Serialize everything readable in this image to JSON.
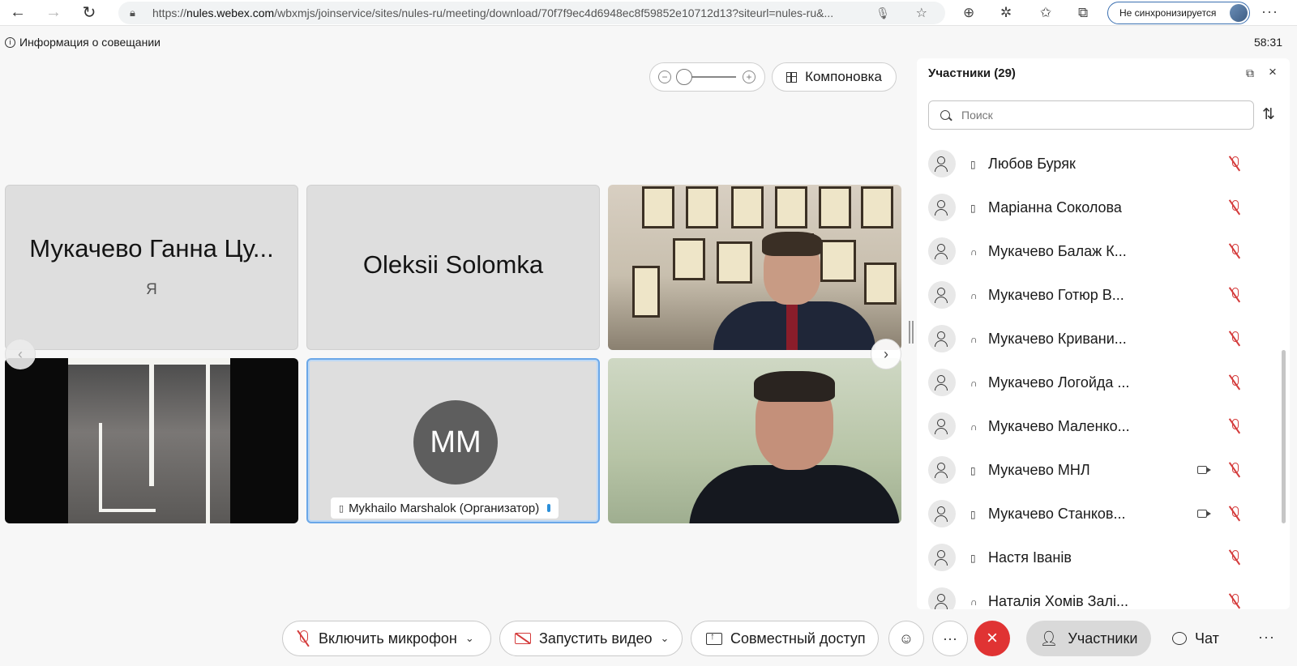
{
  "browser": {
    "url_prefix": "https://",
    "url_host": "nules.webex.com",
    "url_rest": "/wbxmjs/joinservice/sites/nules-ru/meeting/download/70f7f9ec4d6948ec8f59852e10712d13?siteurl=nules-ru&...",
    "profile_status": "Не синхронизируется"
  },
  "meeting": {
    "info_label": "Информация о совещании",
    "timer": "58:31"
  },
  "controls": {
    "layout_label": "Компоновка"
  },
  "tiles": [
    {
      "name": "Мукачево Ганна Цу...",
      "me_label": "Я"
    },
    {
      "name": "Oleksii Solomka"
    },
    {
      "initials": "MM",
      "name": "Mykhailo Marshalok (Организатор)"
    }
  ],
  "panel": {
    "title": "Участники (29)",
    "search_placeholder": "Поиск",
    "participants": [
      {
        "name": "Любов Буряк",
        "device": "phone",
        "video": false
      },
      {
        "name": "Маріанна Соколова",
        "device": "phone",
        "video": false
      },
      {
        "name": "Мукачево Балаж К...",
        "device": "headset",
        "video": false
      },
      {
        "name": "Мукачево Готюр В...",
        "device": "headset",
        "video": false
      },
      {
        "name": "Мукачево Кривани...",
        "device": "headset",
        "video": false
      },
      {
        "name": "Мукачево Логойда ...",
        "device": "headset",
        "video": false
      },
      {
        "name": "Мукачево Маленко...",
        "device": "headset",
        "video": false
      },
      {
        "name": "Мукачево МНЛ",
        "device": "phone",
        "video": true
      },
      {
        "name": "Мукачево Станков...",
        "device": "phone",
        "video": true
      },
      {
        "name": "Настя Іванів",
        "device": "phone",
        "video": false
      },
      {
        "name": "Наталія Хомів Залі...",
        "device": "headset",
        "video": false
      }
    ]
  },
  "bottom": {
    "mic_label": "Включить микрофон",
    "video_label": "Запустить видео",
    "share_label": "Совместный доступ",
    "participants_label": "Участники",
    "chat_label": "Чат"
  }
}
